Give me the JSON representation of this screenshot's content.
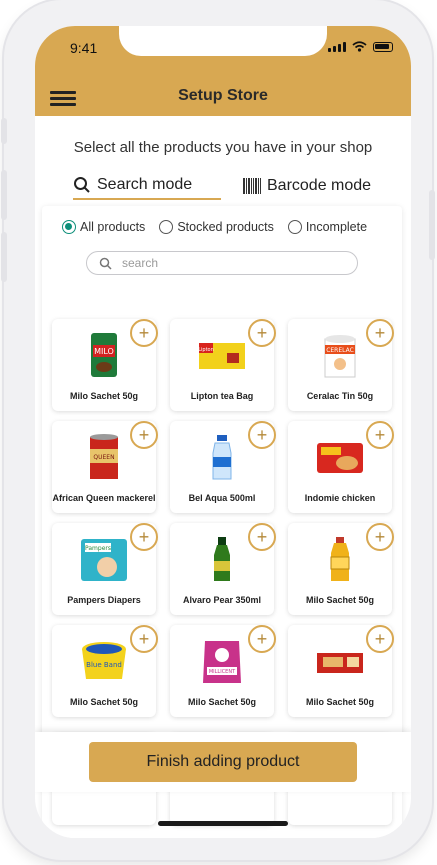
{
  "status_bar": {
    "time": "9:41"
  },
  "header": {
    "title": "Setup Store"
  },
  "instruction": "Select all the products you have in your shop",
  "mode_tabs": [
    {
      "label": "Search mode",
      "active": true,
      "icon": "search-icon"
    },
    {
      "label": "Barcode mode",
      "active": false,
      "icon": "barcode-icon"
    }
  ],
  "filters": [
    {
      "label": "All products",
      "selected": true
    },
    {
      "label": "Stocked products",
      "selected": false
    },
    {
      "label": "Incomplete",
      "selected": false
    }
  ],
  "search": {
    "placeholder": "search",
    "value": ""
  },
  "products": [
    {
      "name": "Milo Sachet 50g",
      "image": "milo-sachet"
    },
    {
      "name": "Lipton tea Bag",
      "image": "lipton-tea-box"
    },
    {
      "name": "Ceralac Tin 50g",
      "image": "ceralac-tin"
    },
    {
      "name": "African Queen mackerel",
      "image": "mackerel-can"
    },
    {
      "name": "Bel Aqua 500ml",
      "image": "water-bottle"
    },
    {
      "name": "Indomie chicken",
      "image": "noodles-pack"
    },
    {
      "name": "Pampers Diapers",
      "image": "diapers-pack"
    },
    {
      "name": "Alvaro Pear 350ml",
      "image": "green-bottle"
    },
    {
      "name": "Milo Sachet 50g",
      "image": "oil-bottle"
    },
    {
      "name": "Milo Sachet 50g",
      "image": "blue-band-tub"
    },
    {
      "name": "Milo Sachet 50g",
      "image": "flour-bag"
    },
    {
      "name": "Milo Sachet 50g",
      "image": "biscuit-box"
    },
    {
      "name": "",
      "image": "blue-band-tub"
    },
    {
      "name": "",
      "image": "flour-bag"
    },
    {
      "name": "",
      "image": "biscuit-box"
    }
  ],
  "add_label": "+",
  "footer": {
    "finish_label": "Finish adding product"
  },
  "colors": {
    "accent": "#d8a852",
    "radio_selected": "#0d8f7a"
  }
}
